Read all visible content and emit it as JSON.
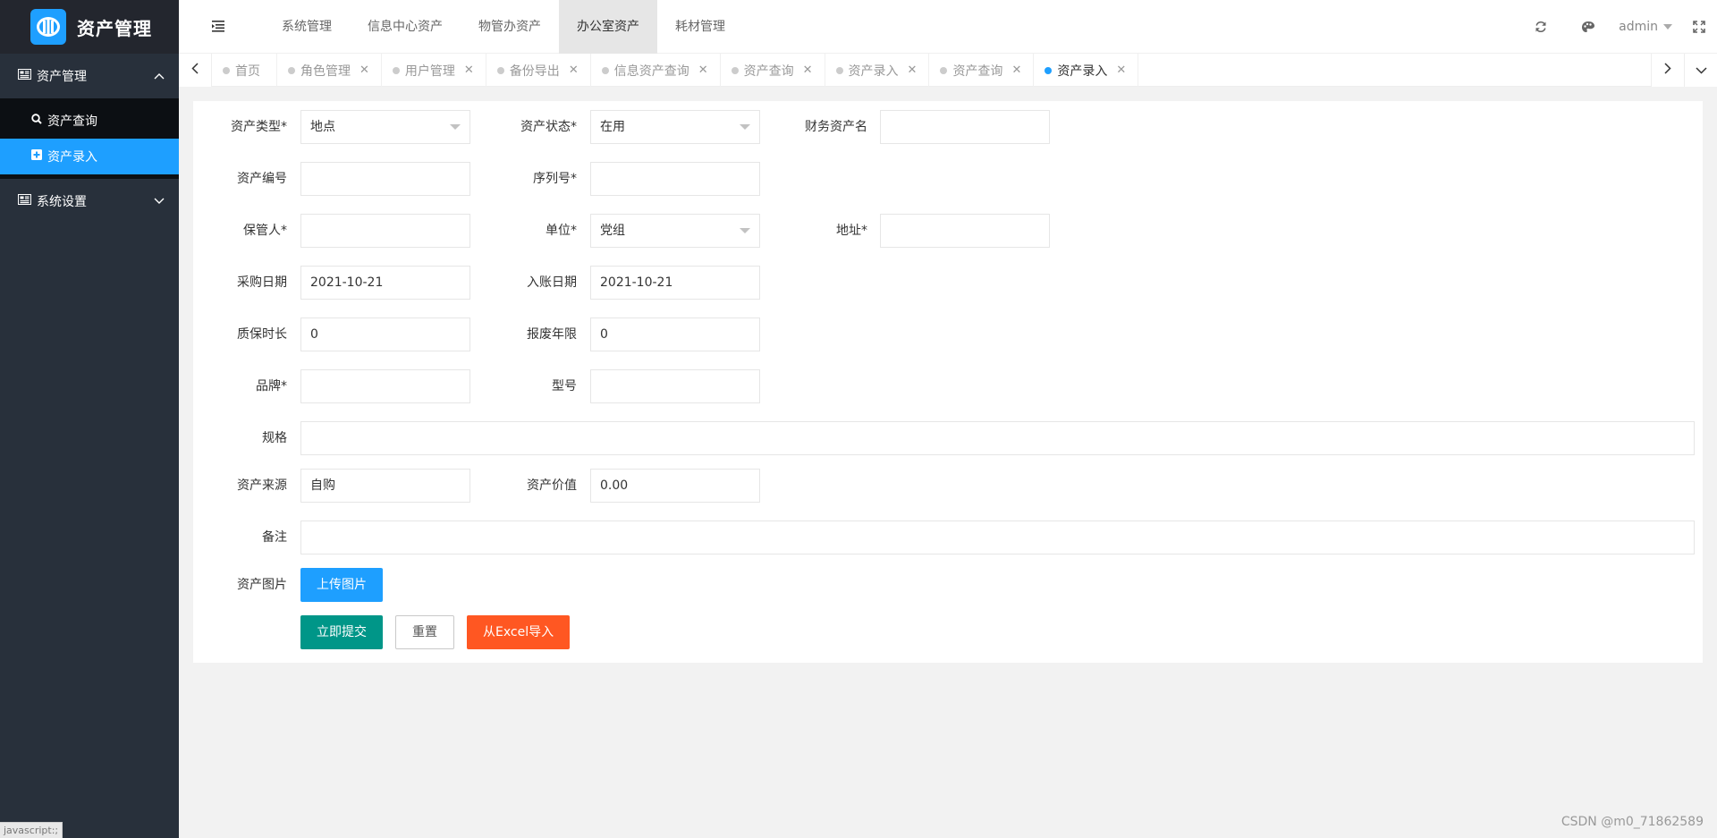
{
  "app": {
    "title": "资产管理"
  },
  "sidebar": {
    "groups": [
      {
        "label": "资产管理",
        "expanded": true,
        "items": [
          {
            "label": "资产查询",
            "icon": "search-icon",
            "active": false
          },
          {
            "label": "资产录入",
            "icon": "plus-square-icon",
            "active": true
          }
        ]
      },
      {
        "label": "系统设置",
        "expanded": false
      }
    ],
    "status_text": "javascript:;"
  },
  "header": {
    "nav": [
      "系统管理",
      "信息中心资产",
      "物管办资产",
      "办公室资产",
      "耗材管理"
    ],
    "active_nav": "办公室资产",
    "user": "admin"
  },
  "tabs": [
    {
      "label": "首页",
      "closable": false
    },
    {
      "label": "角色管理",
      "closable": true
    },
    {
      "label": "用户管理",
      "closable": true
    },
    {
      "label": "备份导出",
      "closable": true
    },
    {
      "label": "信息资产查询",
      "closable": true
    },
    {
      "label": "资产查询",
      "closable": true
    },
    {
      "label": "资产录入",
      "closable": true
    },
    {
      "label": "资产查询",
      "closable": true
    },
    {
      "label": "资产录入",
      "closable": true,
      "active": true
    }
  ],
  "form": {
    "asset_type": {
      "label": "资产类型*",
      "value": "地点"
    },
    "asset_status": {
      "label": "资产状态*",
      "value": "在用"
    },
    "finance_name": {
      "label": "财务资产名",
      "value": ""
    },
    "asset_no": {
      "label": "资产编号",
      "value": ""
    },
    "serial_no": {
      "label": "序列号*",
      "value": ""
    },
    "keeper": {
      "label": "保管人*",
      "value": ""
    },
    "unit": {
      "label": "单位*",
      "value": "党组"
    },
    "address": {
      "label": "地址*",
      "value": ""
    },
    "purchase_date": {
      "label": "采购日期",
      "value": "2021-10-21"
    },
    "entry_date": {
      "label": "入账日期",
      "value": "2021-10-21"
    },
    "warranty": {
      "label": "质保时长",
      "value": "0"
    },
    "scrap_years": {
      "label": "报废年限",
      "value": "0"
    },
    "brand": {
      "label": "品牌*",
      "value": ""
    },
    "model": {
      "label": "型号",
      "value": ""
    },
    "spec": {
      "label": "规格",
      "value": ""
    },
    "source": {
      "label": "资产来源",
      "value": "自购"
    },
    "asset_value": {
      "label": "资产价值",
      "value": "0.00"
    },
    "remark": {
      "label": "备注",
      "value": ""
    },
    "picture": {
      "label": "资产图片",
      "upload_label": "上传图片"
    },
    "buttons": {
      "submit": "立即提交",
      "reset": "重置",
      "excel": "从Excel导入"
    }
  },
  "colors": {
    "primary": "#1e9fff",
    "submit": "#009688",
    "excel": "#ff5722",
    "sidebar": "#28303b"
  },
  "watermark": "CSDN @m0_71862589"
}
